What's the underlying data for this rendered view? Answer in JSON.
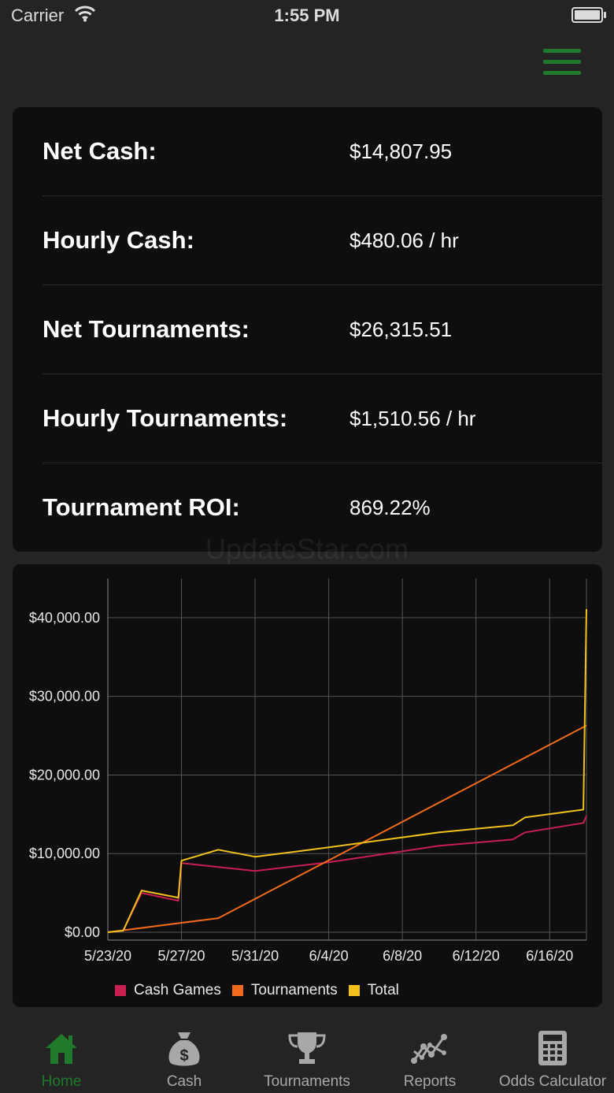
{
  "status_bar": {
    "carrier": "Carrier",
    "time": "1:55 PM"
  },
  "menu": {
    "icon": "hamburger-menu-icon",
    "color": "#1f7a2b"
  },
  "stats": [
    {
      "label": "Net Cash:",
      "value": "$14,807.95"
    },
    {
      "label": "Hourly Cash:",
      "value": "$480.06 / hr"
    },
    {
      "label": "Net Tournaments:",
      "value": "$26,315.51"
    },
    {
      "label": "Hourly Tournaments:",
      "value": "$1,510.56 / hr"
    },
    {
      "label": "Tournament ROI:",
      "value": "869.22%"
    }
  ],
  "watermark": "UpdateStar.com",
  "chart_data": {
    "type": "line",
    "ylim": [
      -1000,
      45000
    ],
    "y_ticks": [
      0,
      10000,
      20000,
      30000,
      40000
    ],
    "y_tick_labels": [
      "$0.00",
      "$10,000.00",
      "$20,000.00",
      "$30,000.00",
      "$40,000.00"
    ],
    "x_ticks": [
      "2020-05-23",
      "2020-05-27",
      "2020-05-31",
      "2020-06-04",
      "2020-06-08",
      "2020-06-12",
      "2020-06-16"
    ],
    "x_tick_labels": [
      "5/23/20",
      "5/27/20",
      "5/31/20",
      "6/4/20",
      "6/8/20",
      "6/12/20",
      "6/16/20"
    ],
    "xlim": [
      "2020-05-23",
      "2020-06-18"
    ],
    "grid": true,
    "legend": "bottom",
    "series": [
      {
        "name": "Cash Games",
        "color": "#c81e50",
        "points": [
          [
            "2020-05-23",
            0
          ],
          [
            "2020-05-23 20:00",
            200
          ],
          [
            "2020-05-24 20:00",
            5000
          ],
          [
            "2020-05-26 20:00",
            4000
          ],
          [
            "2020-05-27",
            8800
          ],
          [
            "2020-05-31",
            7800
          ],
          [
            "2020-06-04",
            8900
          ],
          [
            "2020-06-10",
            11000
          ],
          [
            "2020-06-14",
            11800
          ],
          [
            "2020-06-14 16:00",
            12700
          ],
          [
            "2020-06-17 20:00",
            13900
          ],
          [
            "2020-06-18",
            14800
          ]
        ]
      },
      {
        "name": "Tournaments",
        "color": "#f26a1b",
        "points": [
          [
            "2020-05-23",
            0
          ],
          [
            "2020-05-29",
            1800
          ],
          [
            "2020-06-18",
            26300
          ]
        ]
      },
      {
        "name": "Total",
        "color": "#f2c21b",
        "points": [
          [
            "2020-05-23",
            0
          ],
          [
            "2020-05-23 20:00",
            200
          ],
          [
            "2020-05-24 20:00",
            5300
          ],
          [
            "2020-05-26 20:00",
            4400
          ],
          [
            "2020-05-27",
            9100
          ],
          [
            "2020-05-29",
            10500
          ],
          [
            "2020-05-31",
            9600
          ],
          [
            "2020-06-04",
            10800
          ],
          [
            "2020-06-10",
            12700
          ],
          [
            "2020-06-14",
            13600
          ],
          [
            "2020-06-14 16:00",
            14600
          ],
          [
            "2020-06-17 20:00",
            15600
          ],
          [
            "2020-06-18",
            41100
          ]
        ]
      }
    ]
  },
  "tabs": [
    {
      "label": "Home",
      "icon": "house-icon",
      "active": true
    },
    {
      "label": "Cash",
      "icon": "money-bag-icon",
      "active": false
    },
    {
      "label": "Tournaments",
      "icon": "trophy-icon",
      "active": false
    },
    {
      "label": "Reports",
      "icon": "chart-line-icon",
      "active": false
    },
    {
      "label": "Odds Calculator",
      "icon": "calculator-icon",
      "active": false
    }
  ]
}
